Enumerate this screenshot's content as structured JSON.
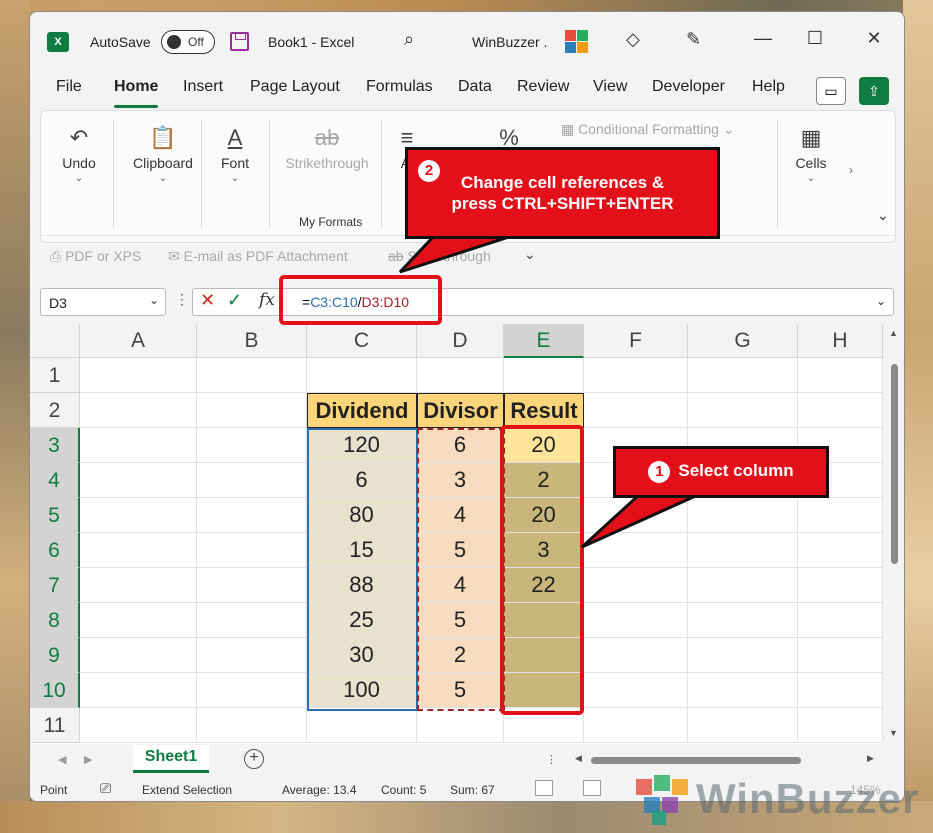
{
  "titlebar": {
    "autosave_label": "AutoSave",
    "autosave_state": "Off",
    "doc_title": "Book1 - Excel",
    "account_name": "WinBuzzer ."
  },
  "menu": [
    "File",
    "Home",
    "Insert",
    "Page Layout",
    "Formulas",
    "Data",
    "Review",
    "View",
    "Developer",
    "Help"
  ],
  "ribbon": {
    "undo": "Undo",
    "clipboard": "Clipboard",
    "font": "Font",
    "strikethrough": "Strikethrough",
    "my_formats": "My Formats",
    "alignment_partial": "Al",
    "conditional_formatting": "Conditional Formatting",
    "cells": "Cells",
    "qat_pdf": "PDF or XPS",
    "qat_email": "E-mail as PDF Attachment",
    "qat_strike": "Strikethrough"
  },
  "formula_bar": {
    "namebox": "D3",
    "fx": "fx",
    "prefix": "=",
    "ref1": "C3:C10",
    "slash": "/",
    "ref2": "D3:D10"
  },
  "grid": {
    "columns": [
      "A",
      "B",
      "C",
      "D",
      "E",
      "F",
      "G",
      "H"
    ],
    "rows": [
      "1",
      "2",
      "3",
      "4",
      "5",
      "6",
      "7",
      "8",
      "9",
      "10",
      "11"
    ],
    "headers": [
      "Dividend",
      "Divisor",
      "Result"
    ],
    "dividend": [
      "120",
      "6",
      "80",
      "15",
      "88",
      "25",
      "30",
      "100"
    ],
    "divisor": [
      "6",
      "3",
      "4",
      "5",
      "4",
      "5",
      "2",
      "5"
    ],
    "result": [
      "20",
      "2",
      "20",
      "3",
      "22",
      "",
      "",
      ""
    ]
  },
  "sheet_tab": "Sheet1",
  "status": {
    "mode": "Point",
    "extend": "Extend Selection",
    "average": "Average: 13.4",
    "count": "Count: 5",
    "sum": "Sum: 67",
    "zoom": "145%"
  },
  "callouts": {
    "one_num": "1",
    "one_text": "Select column",
    "two_num": "2",
    "two_line1": "Change cell references &",
    "two_line2": "press CTRL+SHIFT+ENTER"
  },
  "watermark": "WinBuzzer",
  "colors": {
    "excel_green": "#107c41",
    "callout_red": "#e3101a",
    "ref1_blue": "#2a6db5",
    "ref2_red": "#a3232a"
  }
}
